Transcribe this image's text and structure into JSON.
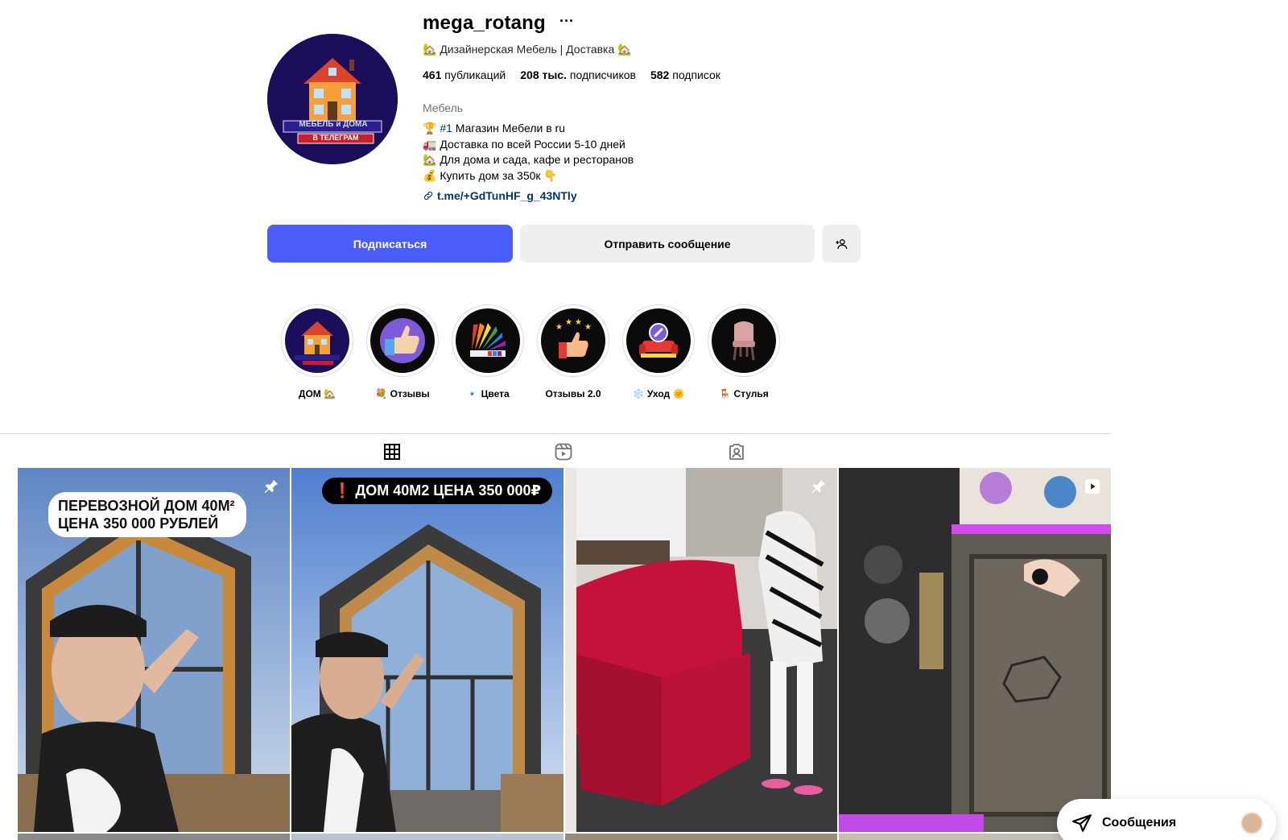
{
  "profile": {
    "username": "mega_rotang",
    "more_label": "···",
    "category_line": "🏡 Дизайнерская Мебель | Доставка 🏡",
    "stats": {
      "posts_value": "461",
      "posts_label": "публикаций",
      "followers_value": "208 тыс.",
      "followers_label": "подписчиков",
      "following_value": "582",
      "following_label": "подписок"
    },
    "category": "Мебель",
    "bio": {
      "line1_prefix": "🏆 ",
      "line1_hash": "#1",
      "line1_rest": " Магазин Мебели в ru",
      "line2": "🚛 Доставка по всей России 5-10 дней",
      "line3": "🏡 Для дома и сада, кафе и ресторанов",
      "line4": "💰 Купить дом за 350к 👇"
    },
    "link": "t.me/+GdTunHF_g_43NTly",
    "avatar_text_line1": "МЕБЕЛЬ и ДОМА",
    "avatar_text_line2": "В ТЕЛЕГРАМ"
  },
  "actions": {
    "follow_label": "Подписаться",
    "message_label": "Отправить сообщение",
    "add_user_icon": "add-user-icon"
  },
  "highlights": [
    {
      "label": "ДОМ 🏡",
      "icon": "house-icon"
    },
    {
      "label": "💐 Отзывы",
      "icon": "thumbs-up-hand-icon"
    },
    {
      "label": "🔹 Цвета",
      "icon": "color-palette-icon"
    },
    {
      "label": "Отзывы 2.0",
      "icon": "thumbs-up-stars-icon"
    },
    {
      "label": "❄️ Уход 🌞",
      "icon": "sofa-care-icon"
    },
    {
      "label": "🪑 Стулья",
      "icon": "chair-icon"
    }
  ],
  "tabs": [
    {
      "name": "posts",
      "icon": "grid-icon",
      "active": true
    },
    {
      "name": "reels",
      "icon": "reels-icon",
      "active": false
    },
    {
      "name": "tagged",
      "icon": "tagged-icon",
      "active": false
    }
  ],
  "posts": [
    {
      "overlay_line1": "ПЕРЕВОЗНОЙ ДОМ 40М²",
      "overlay_line2": "ЦЕНА 350 000 РУБЛЕЙ",
      "icon": "pin-icon"
    },
    {
      "overlay": "❗ ДОМ 40М2 ЦЕНА 350 000₽",
      "icon": ""
    },
    {
      "overlay": "",
      "icon": "pin-icon"
    },
    {
      "overlay": "",
      "icon": "reel-video-icon"
    }
  ],
  "messages": {
    "label": "Сообщения"
  },
  "colors": {
    "primary": "#4a5df9",
    "secondary_button": "#efefef",
    "link": "#00376b",
    "muted": "#737373"
  }
}
